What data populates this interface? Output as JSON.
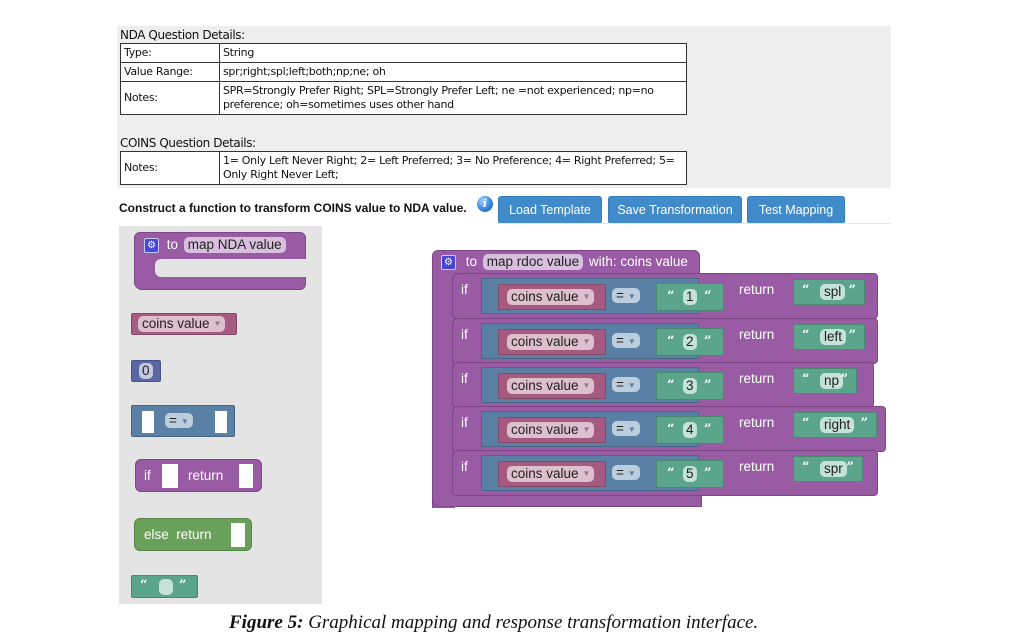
{
  "nda_details": {
    "title": "NDA Question Details:",
    "rows": [
      {
        "key": "Type:",
        "value": "String"
      },
      {
        "key": "Value Range:",
        "value": "spr;right;spl;left;both;np;ne; oh"
      },
      {
        "key": "Notes:",
        "value": "SPR=Strongly Prefer Right; SPL=Strongly Prefer Left; ne =not experienced; np=no preference; oh=sometimes uses other hand"
      }
    ]
  },
  "coins_details": {
    "title": "COINS Question Details:",
    "rows": [
      {
        "key": "Notes:",
        "value": "1= Only Left Never Right; 2= Left Preferred; 3= No Preference; 4= Right Preferred; 5= Only Right Never Left;"
      }
    ]
  },
  "instruction": "Construct a function to transform COINS value to NDA value.",
  "info_icon": "info-icon",
  "buttons": {
    "load_template": "Load Template",
    "save_transformation": "Save Transformation",
    "test_mapping": "Test Mapping"
  },
  "flyout": {
    "function_block": {
      "keyword": "to",
      "name": "map NDA value"
    },
    "variable_block": {
      "name": "coins value"
    },
    "number_block": {
      "value": "0"
    },
    "compare_block": {
      "operator": "="
    },
    "if_return_block": {
      "if_label": "if",
      "return_label": "return"
    },
    "else_return_block": {
      "label": "else  return"
    },
    "text_block": {
      "open_quote": "“",
      "close_quote": "”",
      "value": ""
    }
  },
  "workspace": {
    "function": {
      "keyword": "to",
      "name": "map rdoc value",
      "params": "with: coins value"
    },
    "rows": [
      {
        "if_label": "if",
        "variable": "coins value",
        "operator": "=",
        "compare_value": "1",
        "return_label": "return",
        "return_value": "spl"
      },
      {
        "if_label": "if",
        "variable": "coins value",
        "operator": "=",
        "compare_value": "2",
        "return_label": "return",
        "return_value": "left"
      },
      {
        "if_label": "if",
        "variable": "coins value",
        "operator": "=",
        "compare_value": "3",
        "return_label": "return",
        "return_value": "np"
      },
      {
        "if_label": "if",
        "variable": "coins value",
        "operator": "=",
        "compare_value": "4",
        "return_label": "return",
        "return_value": "right"
      },
      {
        "if_label": "if",
        "variable": "coins value",
        "operator": "=",
        "compare_value": "5",
        "return_label": "return",
        "return_value": "spr"
      }
    ]
  },
  "quotes": {
    "open": "“",
    "close": "”"
  },
  "caption": {
    "label": "Figure 5:",
    "text": " Graphical mapping and response transformation interface."
  },
  "colors": {
    "procedure": "#9a5ba5",
    "logic": "#5b80a5",
    "text": "#5ba58c",
    "variable": "#a55b80",
    "math": "#5b67a5",
    "button": "#428bca"
  }
}
